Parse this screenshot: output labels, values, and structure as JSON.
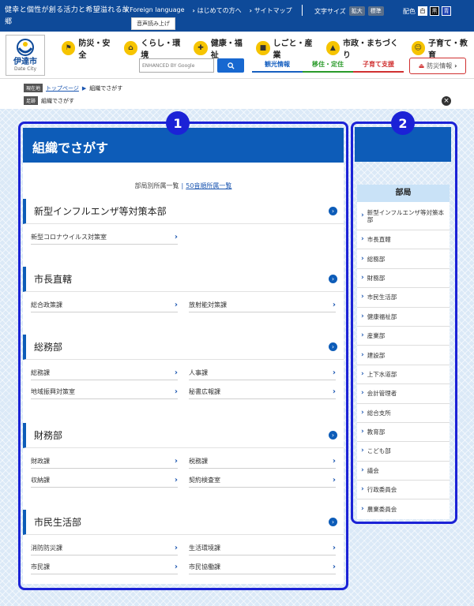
{
  "topbar": {
    "tagline": "健幸と個性が創る活力と希望溢れる故郷",
    "links": [
      "Foreign language",
      "はじめての方へ",
      "サイトマップ"
    ],
    "font_size_label": "文字サイズ",
    "font_enlarge": "拡大",
    "font_standard": "標準",
    "color_label": "配色",
    "color_white": "白",
    "color_black": "黒",
    "color_blue": "青",
    "voice": "音声読み上げ"
  },
  "logo": {
    "ja": "伊達市",
    "en": "Date City"
  },
  "gnav": [
    {
      "label": "防災・安全",
      "icon": "flag-icon"
    },
    {
      "label": "くらし・環境",
      "icon": "home-icon"
    },
    {
      "label": "健康・福祉",
      "icon": "cross-icon"
    },
    {
      "label": "しごと・産業",
      "icon": "briefcase-icon"
    },
    {
      "label": "市政・まちづくり",
      "icon": "building-icon"
    },
    {
      "label": "子育て・教育",
      "icon": "child-icon"
    }
  ],
  "search": {
    "placeholder": "ENHANCED BY Google",
    "button_icon": "search-icon"
  },
  "subnav": [
    "観光情報",
    "移住・定住",
    "子育て支援"
  ],
  "disaster": "防災情報",
  "breadcrumb": {
    "tag": "現在地",
    "home": "トップページ",
    "current": "組織でさがす",
    "tag2": "足跡",
    "history": "組織でさがす"
  },
  "annotations": {
    "one": "1",
    "two": "2"
  },
  "main": {
    "title": "組織でさがす",
    "tab_dept": "部局別所属一覧",
    "tab_kana": "50音順所属一覧",
    "sections": [
      {
        "title": "新型インフルエンザ等対策本部",
        "rows": [
          [
            "新型コロナウイルス対策室"
          ]
        ]
      },
      {
        "title": "市長直轄",
        "rows": [
          [
            "総合政策課",
            "放射能対策課"
          ]
        ]
      },
      {
        "title": "総務部",
        "rows": [
          [
            "総務課",
            "人事課"
          ],
          [
            "地域振興対策室",
            "秘書広報課"
          ]
        ]
      },
      {
        "title": "財務部",
        "rows": [
          [
            "財政課",
            "税務課"
          ],
          [
            "収納課",
            "契約検査室"
          ]
        ]
      },
      {
        "title": "市民生活部",
        "rows": [
          [
            "消防防災課",
            "生活環境課"
          ],
          [
            "市民課",
            "市民協働課"
          ]
        ]
      }
    ]
  },
  "side": {
    "heading": "部局",
    "items": [
      "新型インフルエンザ等対策本部",
      "市長直轄",
      "総務部",
      "財務部",
      "市民生活部",
      "健康福祉部",
      "産業部",
      "建設部",
      "上下水道部",
      "会計管理者",
      "総合支所",
      "教育部",
      "こども部",
      "議会",
      "行政委員会",
      "農業委員会"
    ]
  }
}
